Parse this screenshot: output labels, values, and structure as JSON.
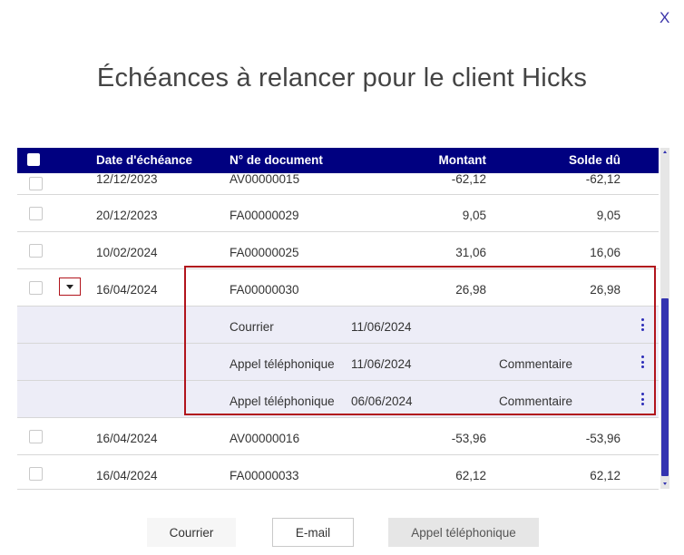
{
  "dialog": {
    "title": "Échéances à relancer pour le client Hicks",
    "close_label": "X"
  },
  "table": {
    "columns": [
      "Date d'échéance",
      "N° de document",
      "Montant",
      "Solde dû"
    ],
    "rows": [
      {
        "date": "12/12/2023",
        "document": "AV00000015",
        "montant": "-62,12",
        "solde": "-62,12"
      },
      {
        "date": "20/12/2023",
        "document": "FA00000029",
        "montant": "9,05",
        "solde": "9,05"
      },
      {
        "date": "10/02/2024",
        "document": "FA00000025",
        "montant": "31,06",
        "solde": "16,06"
      },
      {
        "date": "16/04/2024",
        "document": "FA00000030",
        "montant": "26,98",
        "solde": "26,98"
      },
      {
        "date": "16/04/2024",
        "document": "AV00000016",
        "montant": "-53,96",
        "solde": "-53,96"
      },
      {
        "date": "16/04/2024",
        "document": "FA00000033",
        "montant": "62,12",
        "solde": "62,12"
      }
    ],
    "expanded_details": [
      {
        "type": "Courrier",
        "date": "11/06/2024",
        "comment": ""
      },
      {
        "type": "Appel téléphonique",
        "date": "11/06/2024",
        "comment": "Commentaire"
      },
      {
        "type": "Appel téléphonique",
        "date": "06/06/2024",
        "comment": "Commentaire"
      }
    ]
  },
  "actions": {
    "courrier": "Courrier",
    "email": "E-mail",
    "appel": "Appel téléphonique"
  },
  "colors": {
    "header_bg": "#000080",
    "highlight": "#b1141c",
    "sub_row_bg": "#ededf7",
    "accent": "#3333b0"
  }
}
